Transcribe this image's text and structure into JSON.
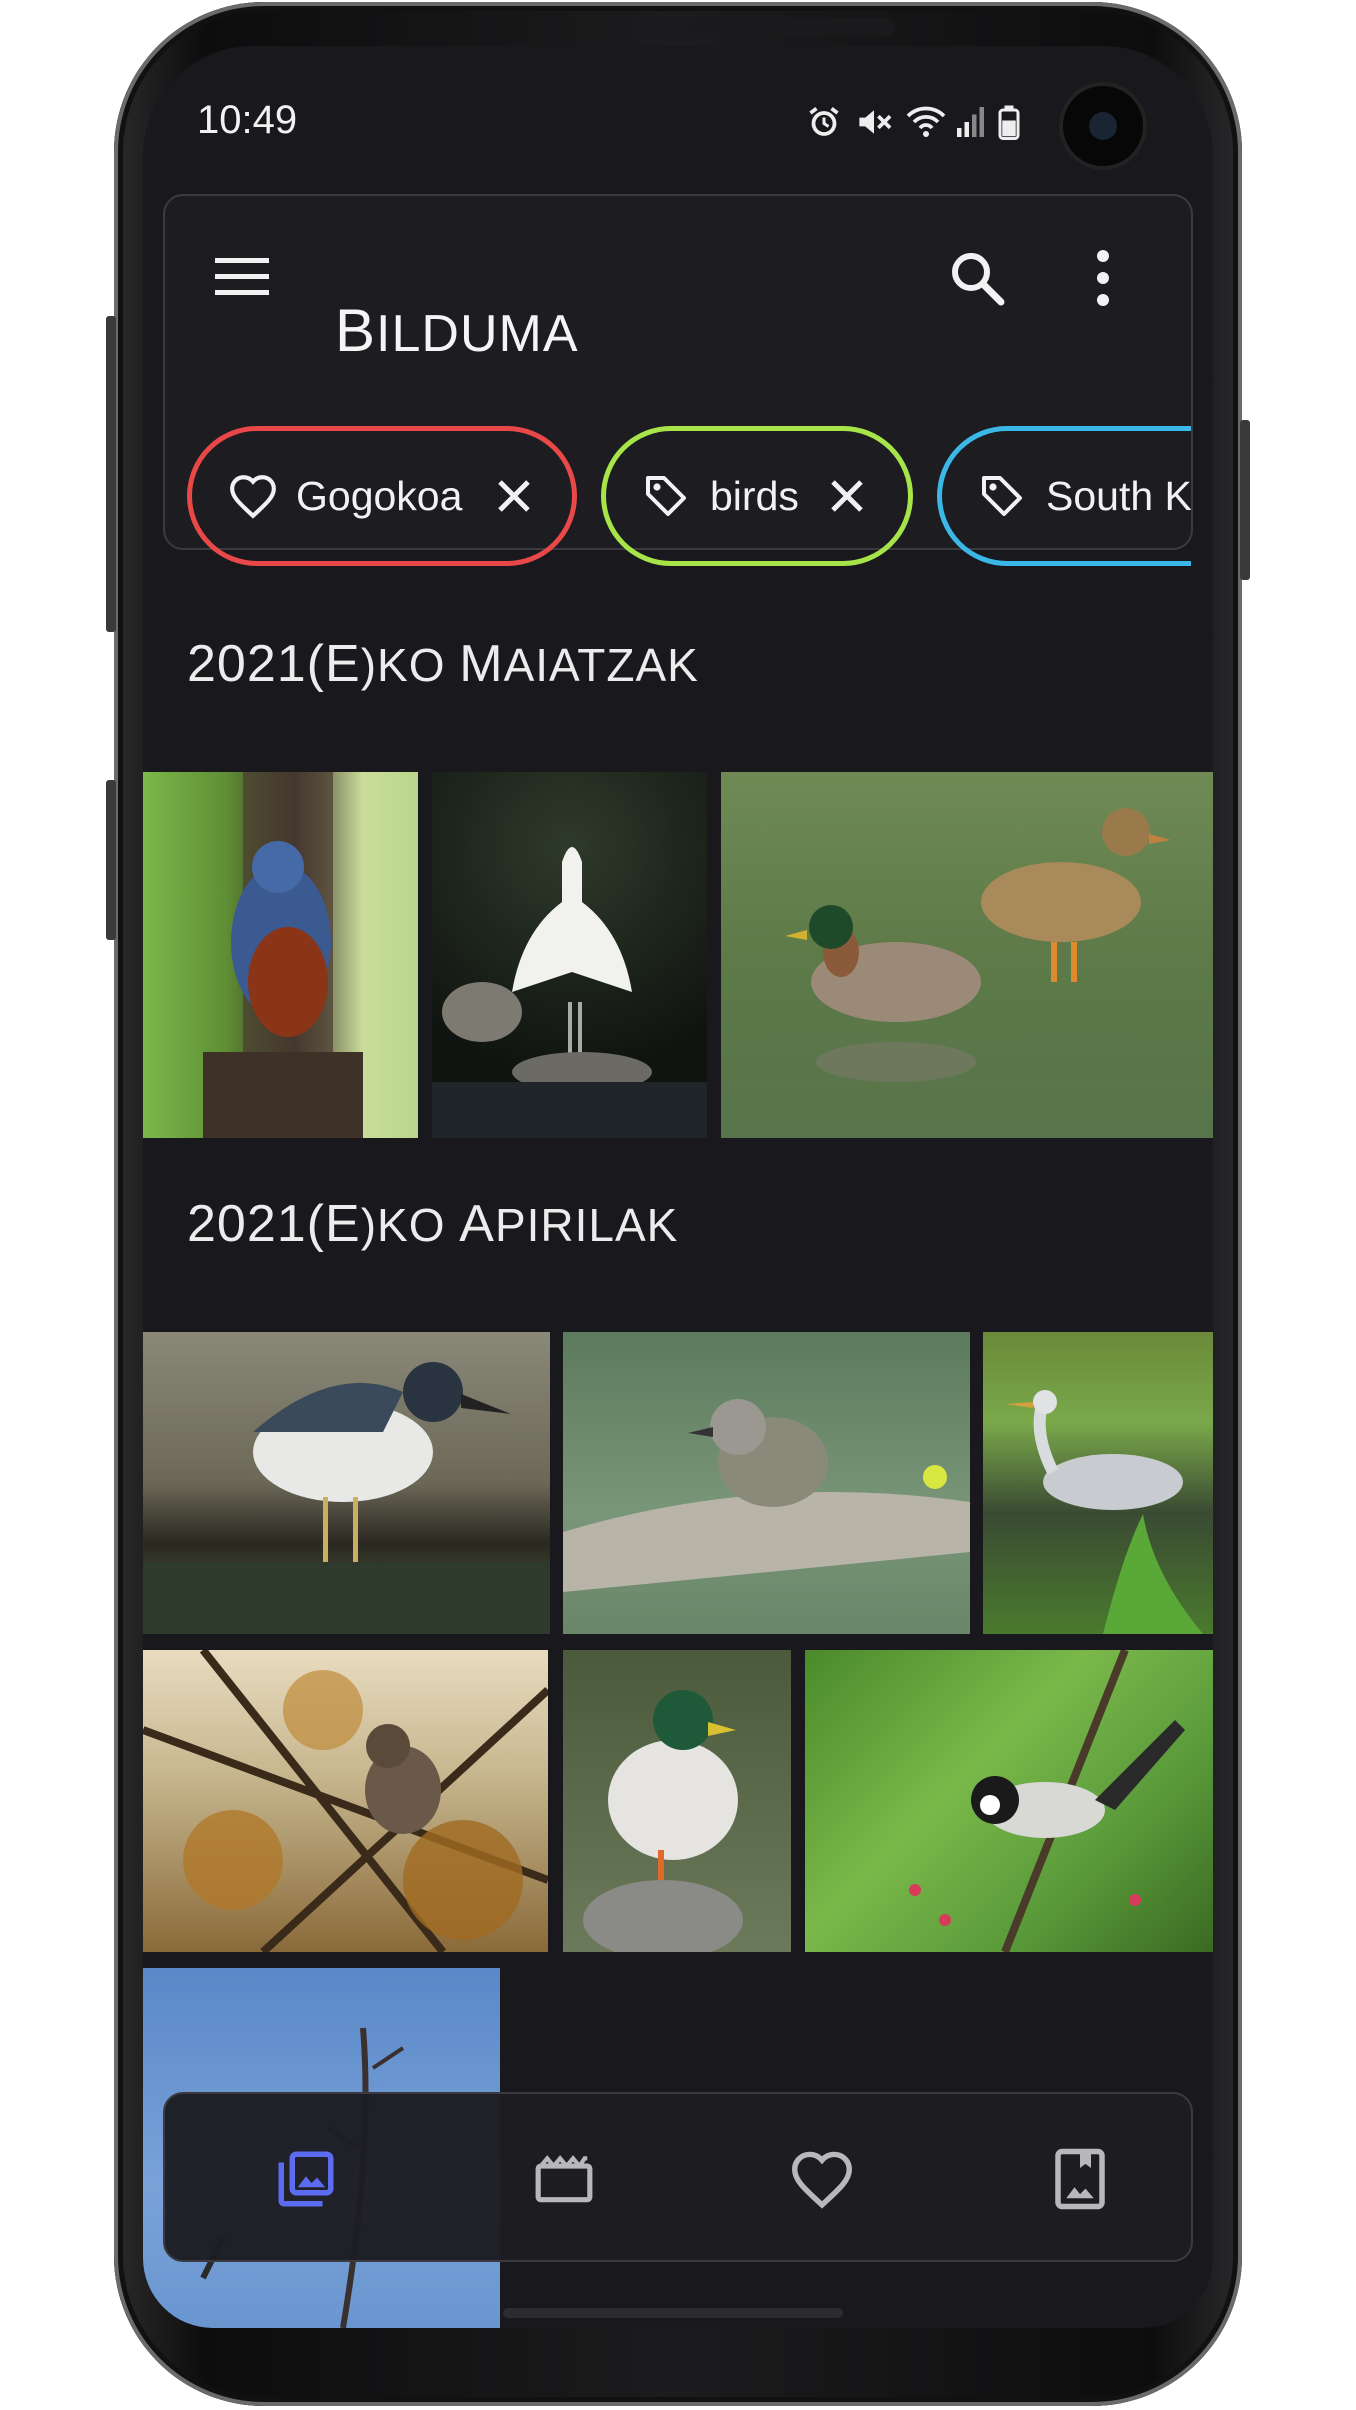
{
  "status_bar": {
    "time": "10:49"
  },
  "app_bar": {
    "title_first": "B",
    "title_rest": "ILDUMA"
  },
  "filters": [
    {
      "label": "Gogokoa",
      "color": "#e84848"
    },
    {
      "label": "birds",
      "color": "#a6e44a"
    },
    {
      "label": "South K",
      "color": "#3bb8e8"
    }
  ],
  "sections": [
    {
      "year": "2021(",
      "e": "E",
      "rest": ")KO ",
      "m1": "M",
      "m1rest": "AIATZAK"
    },
    {
      "year": "2021(",
      "e": "E",
      "rest": ")KO ",
      "m1": "A",
      "m1rest": "PIRILAK"
    }
  ],
  "bottom_nav": [
    "gallery",
    "videos",
    "favourites",
    "albums"
  ],
  "colors": {
    "accent": "#5b6cf0",
    "background": "#19191d"
  }
}
